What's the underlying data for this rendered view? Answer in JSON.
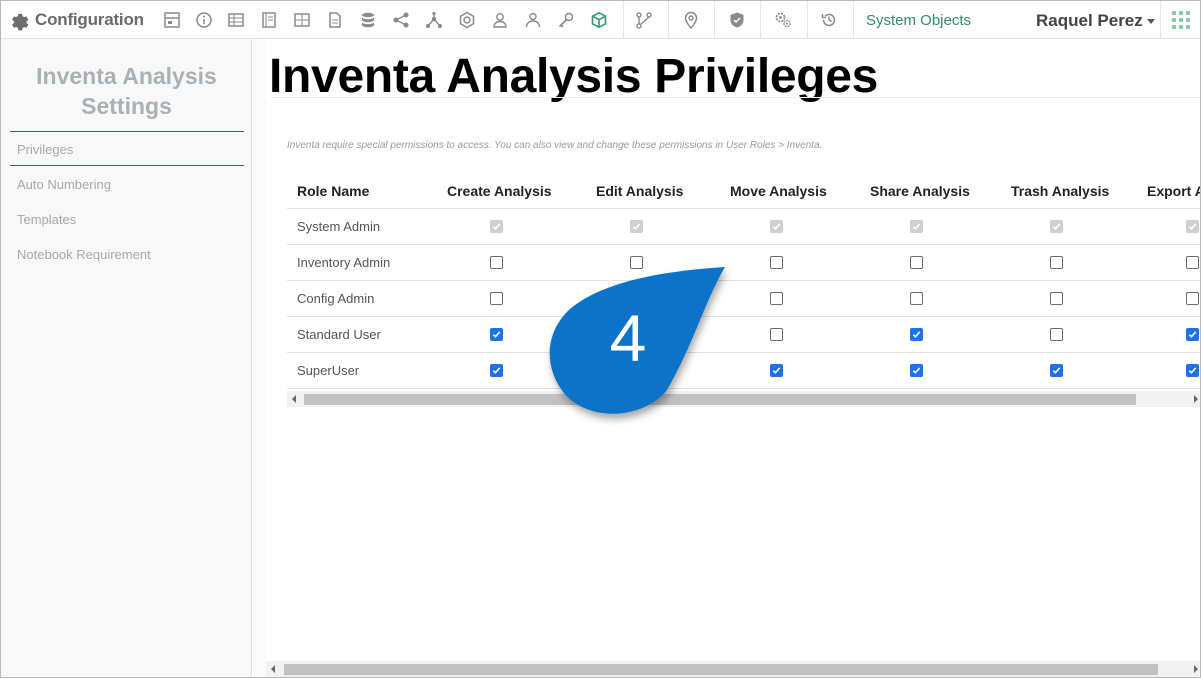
{
  "app": {
    "title": "Configuration",
    "system_objects": "System Objects",
    "user_name": "Raquel Perez"
  },
  "toolbar_icons": [
    "sheet-icon",
    "info-icon",
    "table-icon",
    "notebook-icon",
    "grid-icon",
    "document-icon",
    "database-icon",
    "share-icon",
    "network-icon",
    "badge-icon",
    "user-outline-icon",
    "person-icon",
    "key-icon",
    "cube-icon",
    "workflow-icon",
    "location-icon",
    "shield-icon",
    "gears-icon",
    "history-icon"
  ],
  "sidebar": {
    "title": "Inventa Analysis Settings",
    "items": [
      "Privileges",
      "Auto Numbering",
      "Templates",
      "Notebook Requirement"
    ]
  },
  "main": {
    "title": "Inventa Analysis Privileges",
    "intro": "Inventa require special permissions to access. You can also view and change these permissions in User Roles > Inventa."
  },
  "table": {
    "headers": [
      "Role Name",
      "Create Analysis",
      "Edit Analysis",
      "Move Analysis",
      "Share Analysis",
      "Trash Analysis",
      "Export A"
    ],
    "rows": [
      {
        "role": "System Admin",
        "state": [
          "disabled",
          "disabled",
          "disabled",
          "disabled",
          "disabled",
          "disabled"
        ]
      },
      {
        "role": "Inventory Admin",
        "state": [
          "off",
          "off",
          "off",
          "off",
          "off",
          "off"
        ]
      },
      {
        "role": "Config Admin",
        "state": [
          "off",
          "hidden",
          "off",
          "off",
          "off",
          "off"
        ]
      },
      {
        "role": "Standard User",
        "state": [
          "on",
          "hidden",
          "off",
          "on",
          "off",
          "on"
        ]
      },
      {
        "role": "SuperUser",
        "state": [
          "on",
          "hidden",
          "on",
          "on",
          "on",
          "on"
        ]
      }
    ]
  },
  "callout": {
    "number": "4",
    "color": "#0a73c9"
  },
  "colors": {
    "accent_green": "#2f8c6c",
    "checkbox_blue": "#1a73e8"
  }
}
